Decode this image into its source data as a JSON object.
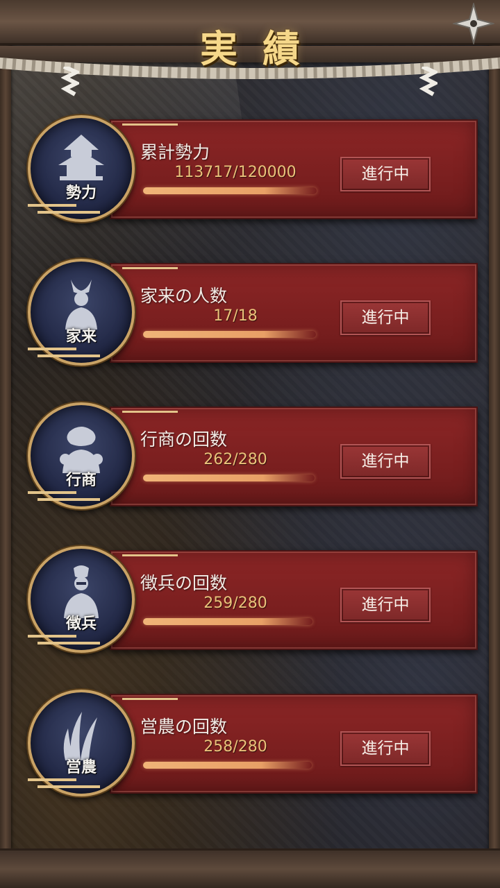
{
  "title": "実績",
  "colors": {
    "panel": "#7a1f1f",
    "gold": "#c9a265",
    "progress_text": "#e9c27a",
    "bar": "#f0b478",
    "medallion": "#1f2542"
  },
  "achievements": [
    {
      "title": "累計勢力",
      "kanji": "勢力",
      "progress_text": "113717/120000",
      "current": 113717,
      "target": 120000,
      "status": "進行中",
      "icon": "castle-icon"
    },
    {
      "title": "家来の人数",
      "kanji": "家来",
      "progress_text": "17/18",
      "current": 17,
      "target": 18,
      "status": "進行中",
      "icon": "samurai-icon"
    },
    {
      "title": "行商の回数",
      "kanji": "行商",
      "progress_text": "262/280",
      "current": 262,
      "target": 280,
      "status": "進行中",
      "icon": "merchant-bag-icon"
    },
    {
      "title": "徴兵の回数",
      "kanji": "徴兵",
      "progress_text": "259/280",
      "current": 259,
      "target": 280,
      "status": "進行中",
      "icon": "soldier-icon"
    },
    {
      "title": "営農の回数",
      "kanji": "営農",
      "progress_text": "258/280",
      "current": 258,
      "target": 280,
      "status": "進行中",
      "icon": "rice-icon"
    }
  ]
}
